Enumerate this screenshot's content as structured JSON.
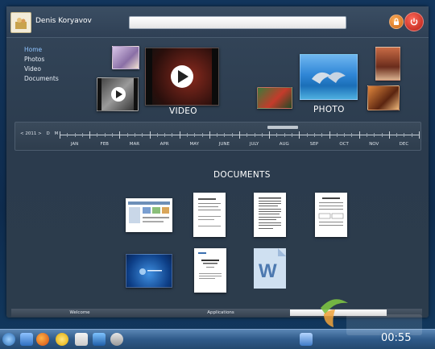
{
  "header": {
    "user_name": "Denis Koryavov",
    "search_placeholder": ""
  },
  "nav": {
    "items": [
      "Home",
      "Photos",
      "Video",
      "Documents"
    ],
    "active_index": 0
  },
  "sections": {
    "video_title": "VIDEO",
    "photo_title": "PHOTO",
    "documents_title": "DOCUMENTS"
  },
  "timeline": {
    "year_nav": "< 2011 >",
    "mode_d": "D",
    "mode_m": "M",
    "months": [
      "JAN",
      "FEB",
      "MAR",
      "APR",
      "MAY",
      "JUNE",
      "JULY",
      "AUG",
      "SEP",
      "OCT",
      "NOV",
      "DEC"
    ],
    "highlighted_month": "AUG"
  },
  "tabs": {
    "welcome": "Welcome",
    "applications": "Applications"
  },
  "taskbar": {
    "clock": "00:55"
  },
  "icons": {
    "lock": "lock-icon",
    "power": "power-icon",
    "play": "play-icon"
  },
  "colors": {
    "accent_nav": "#8fc4ff",
    "power": "#d8231a",
    "lock": "#f08a2a"
  }
}
